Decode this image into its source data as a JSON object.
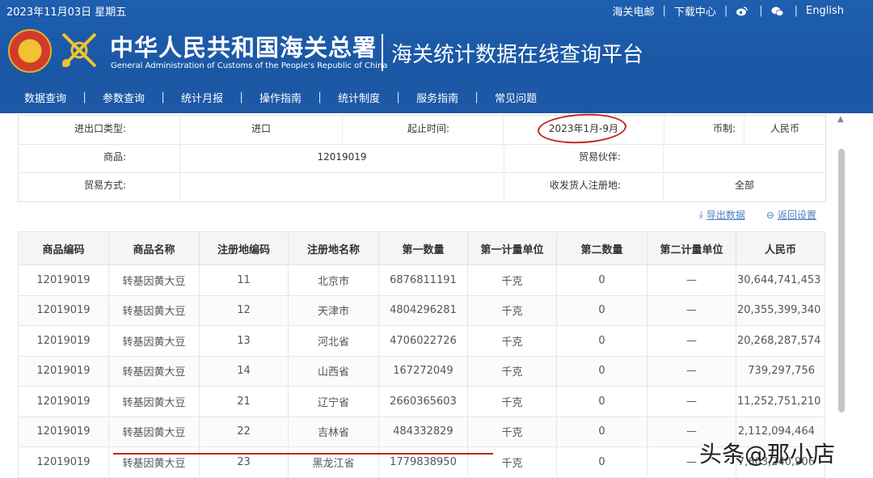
{
  "header": {
    "date": "2023年11月03日 星期五",
    "links": [
      "海关电邮",
      "下载中心"
    ],
    "english_label": "English",
    "title_cn": "中华人民共和国海关总署",
    "title_en": "General Administration of Customs of the People's Republic of China",
    "platform": "海关统计数据在线查询平台"
  },
  "nav": {
    "items": [
      "数据查询",
      "参数查询",
      "统计月报",
      "操作指南",
      "统计制度",
      "服务指南",
      "常见问题"
    ],
    "separator": "|"
  },
  "filters": {
    "trade_type_label": "进出口类型:",
    "trade_type_value": "进口",
    "period_label": "起止时间:",
    "period_value": "2023年1月-9月",
    "currency_label": "币制:",
    "currency_value": "人民币",
    "commodity_label": "商品:",
    "commodity_value": "12019019",
    "partner_label": "贸易伙伴:",
    "partner_value": "",
    "trade_mode_label": "贸易方式:",
    "trade_mode_value": "",
    "consignee_label": "收发货人注册地:",
    "consignee_value": "全部"
  },
  "actions": {
    "export": "导出数据",
    "back": "返回设置"
  },
  "table": {
    "columns": [
      "商品编码",
      "商品名称",
      "注册地编码",
      "注册地名称",
      "第一数量",
      "第一计量单位",
      "第二数量",
      "第二计量单位",
      "人民币"
    ],
    "rows": [
      [
        "12019019",
        "转基因黄大豆",
        "11",
        "北京市",
        "6876811191",
        "千克",
        "0",
        "—",
        "30,644,741,453"
      ],
      [
        "12019019",
        "转基因黄大豆",
        "12",
        "天津市",
        "4804296281",
        "千克",
        "0",
        "—",
        "20,355,399,340"
      ],
      [
        "12019019",
        "转基因黄大豆",
        "13",
        "河北省",
        "4706022726",
        "千克",
        "0",
        "—",
        "20,268,287,574"
      ],
      [
        "12019019",
        "转基因黄大豆",
        "14",
        "山西省",
        "167272049",
        "千克",
        "0",
        "—",
        "739,297,756"
      ],
      [
        "12019019",
        "转基因黄大豆",
        "21",
        "辽宁省",
        "2660365603",
        "千克",
        "0",
        "—",
        "11,252,751,210"
      ],
      [
        "12019019",
        "转基因黄大豆",
        "22",
        "吉林省",
        "484332829",
        "千克",
        "0",
        "—",
        "2,112,094,464"
      ],
      [
        "12019019",
        "转基因黄大豆",
        "23",
        "黑龙江省",
        "1779838950",
        "千克",
        "0",
        "—",
        "7,603,240,906"
      ]
    ]
  },
  "watermark": "头条@那小店",
  "colors": {
    "header_blue": "#1a56a2",
    "nav_blue": "#1c58a6",
    "link_blue": "#4a7fc1",
    "annotation_red": "#c0271d"
  }
}
